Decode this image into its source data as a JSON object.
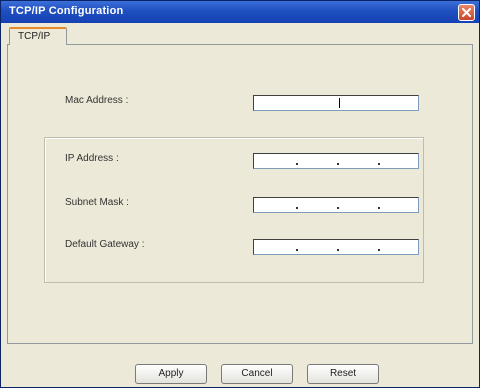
{
  "window": {
    "title": "TCP/IP Configuration"
  },
  "tabs": [
    {
      "label": "TCP/IP"
    }
  ],
  "fields": {
    "mac_label": "Mac Address :",
    "ip_label": "IP Address :",
    "subnet_label": "Subnet Mask :",
    "gateway_label": "Default Gateway :"
  },
  "buttons": {
    "apply": "Apply",
    "cancel": "Cancel",
    "reset": "Reset"
  },
  "icons": {
    "close": "close-icon"
  },
  "colors": {
    "titlebar": "#1f4fc0",
    "close": "#c9472a",
    "tab_highlight": "#e68b2c"
  }
}
